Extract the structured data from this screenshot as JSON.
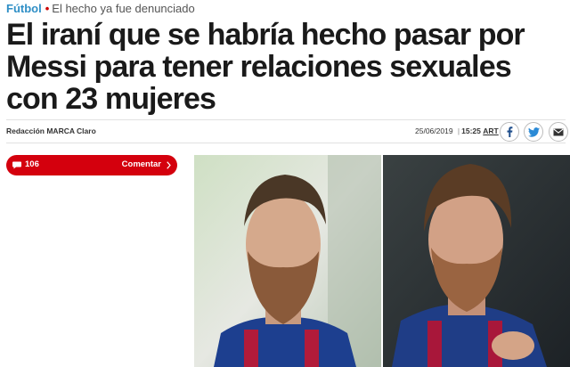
{
  "kicker": {
    "section": "Fútbol",
    "bullet": "•",
    "subtitle": "El hecho ya fue denunciado"
  },
  "headline": "El iraní que se habría hecho pasar por Messi para tener relaciones sexuales con 23 mujeres",
  "byline": "Redacción MARCA Claro",
  "dateline": {
    "date": "25/06/2019",
    "separator": "|",
    "time": "15:25",
    "timezone": "ART"
  },
  "comments": {
    "count": "106",
    "label": "Comentar"
  },
  "colors": {
    "accent_red": "#d4000d",
    "section_blue": "#2f8fc6",
    "social_border": "#bcbcbc"
  },
  "icons": [
    "facebook-icon",
    "twitter-icon",
    "mail-icon",
    "comment-bubble-icon",
    "chevron-right-icon"
  ]
}
